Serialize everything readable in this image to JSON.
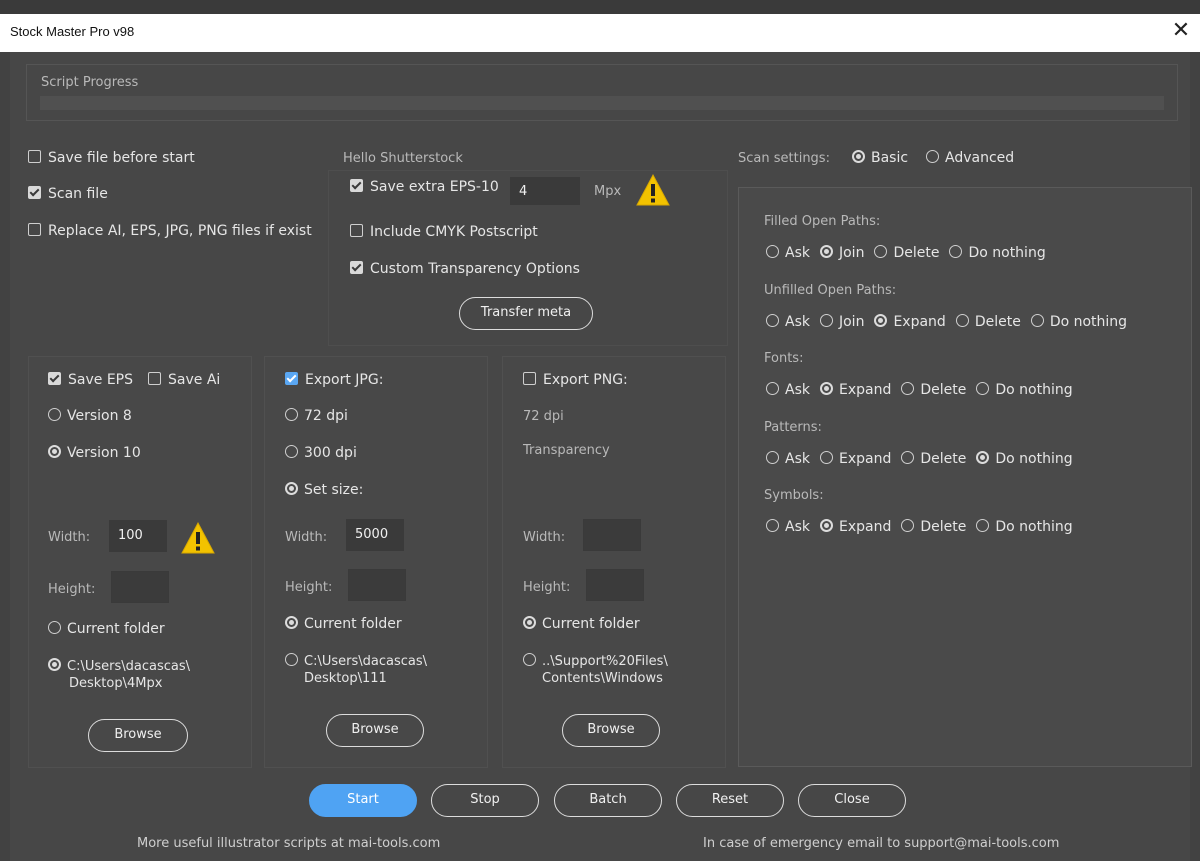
{
  "window": {
    "title": "Stock Master Pro v98"
  },
  "progress": {
    "label": "Script Progress"
  },
  "general": {
    "save_before_start": "Save file before start",
    "scan_file": "Scan file",
    "replace_files": "Replace AI, EPS, JPG, PNG files if exist"
  },
  "shutterstock": {
    "title": "Hello Shutterstock",
    "save_extra_eps": "Save extra EPS-10",
    "mpx_value": "4",
    "mpx_unit": "Mpx",
    "include_cmyk": "Include CMYK Postscript",
    "custom_transparency": "Custom Transparency Options",
    "transfer_meta": "Transfer meta"
  },
  "scan_settings": {
    "label": "Scan settings:",
    "basic": "Basic",
    "advanced": "Advanced"
  },
  "options": {
    "filled_open_paths": {
      "title": "Filled Open Paths:",
      "items": [
        "Ask",
        "Join",
        "Delete",
        "Do nothing"
      ],
      "selected": "Join"
    },
    "unfilled_open_paths": {
      "title": "Unfilled Open Paths:",
      "items": [
        "Ask",
        "Join",
        "Expand",
        "Delete",
        "Do nothing"
      ],
      "selected": "Expand"
    },
    "fonts": {
      "title": "Fonts:",
      "items": [
        "Ask",
        "Expand",
        "Delete",
        "Do nothing"
      ],
      "selected": "Expand"
    },
    "patterns": {
      "title": "Patterns:",
      "items": [
        "Ask",
        "Expand",
        "Delete",
        "Do nothing"
      ],
      "selected": "Do nothing"
    },
    "symbols": {
      "title": "Symbols:",
      "items": [
        "Ask",
        "Expand",
        "Delete",
        "Do nothing"
      ],
      "selected": "Expand"
    }
  },
  "eps": {
    "save_eps": "Save EPS",
    "save_ai": "Save Ai",
    "version8": "Version 8",
    "version10": "Version 10",
    "width_label": "Width:",
    "width_value": "100",
    "height_label": "Height:",
    "height_value": "",
    "current_folder": "Current folder",
    "path_line1": "C:\\Users\\dacascas\\",
    "path_line2": "Desktop\\4Mpx",
    "browse": "Browse"
  },
  "jpg": {
    "export_jpg": "Export JPG:",
    "dpi72": "72 dpi",
    "dpi300": "300 dpi",
    "set_size": "Set size:",
    "width_label": "Width:",
    "width_value": "5000",
    "height_label": "Height:",
    "height_value": "",
    "current_folder": "Current folder",
    "path_line1": "C:\\Users\\dacascas\\",
    "path_line2": "Desktop\\111",
    "browse": "Browse"
  },
  "png": {
    "export_png": "Export PNG:",
    "dpi72": "72 dpi",
    "transparency": "Transparency",
    "width_label": "Width:",
    "width_value": "",
    "height_label": "Height:",
    "height_value": "",
    "current_folder": "Current folder",
    "path_line1": "..\\Support%20Files\\",
    "path_line2": "Contents\\Windows",
    "browse": "Browse"
  },
  "buttons": {
    "start": "Start",
    "stop": "Stop",
    "batch": "Batch",
    "reset": "Reset",
    "close": "Close"
  },
  "footer": {
    "left": "More useful illustrator scripts at mai-tools.com",
    "right": "In case of emergency email to support@mai-tools.com"
  },
  "icons": {
    "warning": "warning-icon",
    "close": "close-icon"
  },
  "colors": {
    "accent": "#4fa3f3",
    "background": "#474747",
    "warning": "#f2c200"
  }
}
